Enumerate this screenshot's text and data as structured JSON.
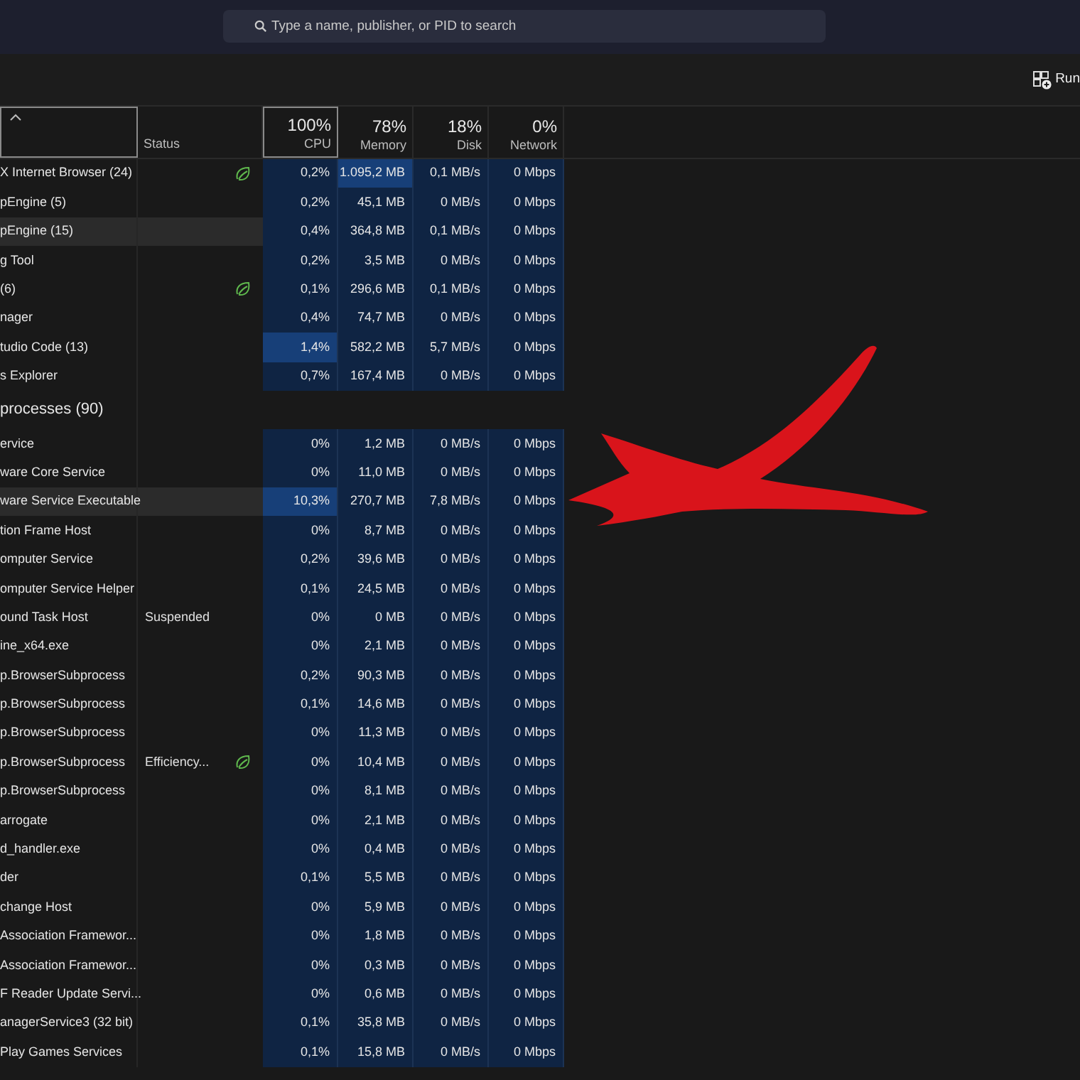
{
  "search": {
    "placeholder": "Type a name, publisher, or PID to search"
  },
  "toolbar": {
    "run_button": "Run"
  },
  "columns": [
    {
      "sort_indicator": true,
      "framed": true
    },
    {
      "label": "Status",
      "framed": false
    },
    {
      "percent": "100%",
      "label": "CPU",
      "framed": true
    },
    {
      "percent": "78%",
      "label": "Memory",
      "framed": false
    },
    {
      "percent": "18%",
      "label": "Disk",
      "framed": false
    },
    {
      "percent": "0%",
      "label": "Network",
      "framed": false
    }
  ],
  "rows": [
    {
      "kind": "process",
      "name": "X Internet Browser (24)",
      "status": "",
      "efficiency": true,
      "highlighted": false,
      "cells": [
        {
          "text": "0,2%",
          "hot": false
        },
        {
          "text": "1.095,2 MB",
          "hot": true
        },
        {
          "text": "0,1 MB/s",
          "hot": false
        },
        {
          "text": "0 Mbps",
          "hot": false
        }
      ]
    },
    {
      "kind": "process",
      "name": "pEngine (5)",
      "status": "",
      "efficiency": false,
      "highlighted": false,
      "cells": [
        {
          "text": "0,2%",
          "hot": false
        },
        {
          "text": "45,1 MB",
          "hot": false
        },
        {
          "text": "0 MB/s",
          "hot": false
        },
        {
          "text": "0 Mbps",
          "hot": false
        }
      ]
    },
    {
      "kind": "process",
      "name": "pEngine (15)",
      "status": "",
      "efficiency": false,
      "highlighted": true,
      "cells": [
        {
          "text": "0,4%",
          "hot": false
        },
        {
          "text": "364,8 MB",
          "hot": false
        },
        {
          "text": "0,1 MB/s",
          "hot": false
        },
        {
          "text": "0 Mbps",
          "hot": false
        }
      ]
    },
    {
      "kind": "process",
      "name": "g Tool",
      "status": "",
      "efficiency": false,
      "highlighted": false,
      "cells": [
        {
          "text": "0,2%",
          "hot": false
        },
        {
          "text": "3,5 MB",
          "hot": false
        },
        {
          "text": "0 MB/s",
          "hot": false
        },
        {
          "text": "0 Mbps",
          "hot": false
        }
      ]
    },
    {
      "kind": "process",
      "name": "(6)",
      "status": "",
      "efficiency": true,
      "highlighted": false,
      "cells": [
        {
          "text": "0,1%",
          "hot": false
        },
        {
          "text": "296,6 MB",
          "hot": false
        },
        {
          "text": "0,1 MB/s",
          "hot": false
        },
        {
          "text": "0 Mbps",
          "hot": false
        }
      ]
    },
    {
      "kind": "process",
      "name": "nager",
      "status": "",
      "efficiency": false,
      "highlighted": false,
      "cells": [
        {
          "text": "0,4%",
          "hot": false
        },
        {
          "text": "74,7 MB",
          "hot": false
        },
        {
          "text": "0 MB/s",
          "hot": false
        },
        {
          "text": "0 Mbps",
          "hot": false
        }
      ]
    },
    {
      "kind": "process",
      "name": "tudio Code (13)",
      "status": "",
      "efficiency": false,
      "highlighted": false,
      "cells": [
        {
          "text": "1,4%",
          "hot": true
        },
        {
          "text": "582,2 MB",
          "hot": false
        },
        {
          "text": "5,7 MB/s",
          "hot": false
        },
        {
          "text": "0 Mbps",
          "hot": false
        }
      ]
    },
    {
      "kind": "process",
      "name": "s Explorer",
      "status": "",
      "efficiency": false,
      "highlighted": false,
      "cells": [
        {
          "text": "0,7%",
          "hot": false
        },
        {
          "text": "167,4 MB",
          "hot": false
        },
        {
          "text": "0 MB/s",
          "hot": false
        },
        {
          "text": "0 Mbps",
          "hot": false
        }
      ]
    },
    {
      "kind": "group",
      "name": "processes (90)"
    },
    {
      "kind": "process",
      "name": "ervice",
      "status": "",
      "efficiency": false,
      "highlighted": false,
      "cells": [
        {
          "text": "0%",
          "hot": false
        },
        {
          "text": "1,2 MB",
          "hot": false
        },
        {
          "text": "0 MB/s",
          "hot": false
        },
        {
          "text": "0 Mbps",
          "hot": false
        }
      ]
    },
    {
      "kind": "process",
      "name": "ware Core Service",
      "status": "",
      "efficiency": false,
      "highlighted": false,
      "cells": [
        {
          "text": "0%",
          "hot": false
        },
        {
          "text": "11,0 MB",
          "hot": false
        },
        {
          "text": "0 MB/s",
          "hot": false
        },
        {
          "text": "0 Mbps",
          "hot": false
        }
      ]
    },
    {
      "kind": "process",
      "name": "ware Service Executable",
      "status": "",
      "efficiency": false,
      "highlighted": true,
      "cells": [
        {
          "text": "10,3%",
          "hot": true
        },
        {
          "text": "270,7 MB",
          "hot": false
        },
        {
          "text": "7,8 MB/s",
          "hot": false
        },
        {
          "text": "0 Mbps",
          "hot": false
        }
      ]
    },
    {
      "kind": "process",
      "name": "tion Frame Host",
      "status": "",
      "efficiency": false,
      "highlighted": false,
      "cells": [
        {
          "text": "0%",
          "hot": false
        },
        {
          "text": "8,7 MB",
          "hot": false
        },
        {
          "text": "0 MB/s",
          "hot": false
        },
        {
          "text": "0 Mbps",
          "hot": false
        }
      ]
    },
    {
      "kind": "process",
      "name": "omputer Service",
      "status": "",
      "efficiency": false,
      "highlighted": false,
      "cells": [
        {
          "text": "0,2%",
          "hot": false
        },
        {
          "text": "39,6 MB",
          "hot": false
        },
        {
          "text": "0 MB/s",
          "hot": false
        },
        {
          "text": "0 Mbps",
          "hot": false
        }
      ]
    },
    {
      "kind": "process",
      "name": "omputer Service Helper",
      "status": "",
      "efficiency": false,
      "highlighted": false,
      "cells": [
        {
          "text": "0,1%",
          "hot": false
        },
        {
          "text": "24,5 MB",
          "hot": false
        },
        {
          "text": "0 MB/s",
          "hot": false
        },
        {
          "text": "0 Mbps",
          "hot": false
        }
      ]
    },
    {
      "kind": "process",
      "name": "ound Task Host",
      "status": "Suspended",
      "efficiency": false,
      "highlighted": false,
      "cells": [
        {
          "text": "0%",
          "hot": false
        },
        {
          "text": "0 MB",
          "hot": false
        },
        {
          "text": "0 MB/s",
          "hot": false
        },
        {
          "text": "0 Mbps",
          "hot": false
        }
      ]
    },
    {
      "kind": "process",
      "name": "ine_x64.exe",
      "status": "",
      "efficiency": false,
      "highlighted": false,
      "cells": [
        {
          "text": "0%",
          "hot": false
        },
        {
          "text": "2,1 MB",
          "hot": false
        },
        {
          "text": "0 MB/s",
          "hot": false
        },
        {
          "text": "0 Mbps",
          "hot": false
        }
      ]
    },
    {
      "kind": "process",
      "name": "p.BrowserSubprocess",
      "status": "",
      "efficiency": false,
      "highlighted": false,
      "cells": [
        {
          "text": "0,2%",
          "hot": false
        },
        {
          "text": "90,3 MB",
          "hot": false
        },
        {
          "text": "0 MB/s",
          "hot": false
        },
        {
          "text": "0 Mbps",
          "hot": false
        }
      ]
    },
    {
      "kind": "process",
      "name": "p.BrowserSubprocess",
      "status": "",
      "efficiency": false,
      "highlighted": false,
      "cells": [
        {
          "text": "0,1%",
          "hot": false
        },
        {
          "text": "14,6 MB",
          "hot": false
        },
        {
          "text": "0 MB/s",
          "hot": false
        },
        {
          "text": "0 Mbps",
          "hot": false
        }
      ]
    },
    {
      "kind": "process",
      "name": "p.BrowserSubprocess",
      "status": "",
      "efficiency": false,
      "highlighted": false,
      "cells": [
        {
          "text": "0%",
          "hot": false
        },
        {
          "text": "11,3 MB",
          "hot": false
        },
        {
          "text": "0 MB/s",
          "hot": false
        },
        {
          "text": "0 Mbps",
          "hot": false
        }
      ]
    },
    {
      "kind": "process",
      "name": "p.BrowserSubprocess",
      "status": "Efficiency...",
      "efficiency": true,
      "highlighted": false,
      "cells": [
        {
          "text": "0%",
          "hot": false
        },
        {
          "text": "10,4 MB",
          "hot": false
        },
        {
          "text": "0 MB/s",
          "hot": false
        },
        {
          "text": "0 Mbps",
          "hot": false
        }
      ]
    },
    {
      "kind": "process",
      "name": "p.BrowserSubprocess",
      "status": "",
      "efficiency": false,
      "highlighted": false,
      "cells": [
        {
          "text": "0%",
          "hot": false
        },
        {
          "text": "8,1 MB",
          "hot": false
        },
        {
          "text": "0 MB/s",
          "hot": false
        },
        {
          "text": "0 Mbps",
          "hot": false
        }
      ]
    },
    {
      "kind": "process",
      "name": "arrogate",
      "status": "",
      "efficiency": false,
      "highlighted": false,
      "cells": [
        {
          "text": "0%",
          "hot": false
        },
        {
          "text": "2,1 MB",
          "hot": false
        },
        {
          "text": "0 MB/s",
          "hot": false
        },
        {
          "text": "0 Mbps",
          "hot": false
        }
      ]
    },
    {
      "kind": "process",
      "name": "d_handler.exe",
      "status": "",
      "efficiency": false,
      "highlighted": false,
      "cells": [
        {
          "text": "0%",
          "hot": false
        },
        {
          "text": "0,4 MB",
          "hot": false
        },
        {
          "text": "0 MB/s",
          "hot": false
        },
        {
          "text": "0 Mbps",
          "hot": false
        }
      ]
    },
    {
      "kind": "process",
      "name": "der",
      "status": "",
      "efficiency": false,
      "highlighted": false,
      "cells": [
        {
          "text": "0,1%",
          "hot": false
        },
        {
          "text": "5,5 MB",
          "hot": false
        },
        {
          "text": "0 MB/s",
          "hot": false
        },
        {
          "text": "0 Mbps",
          "hot": false
        }
      ]
    },
    {
      "kind": "process",
      "name": "change Host",
      "status": "",
      "efficiency": false,
      "highlighted": false,
      "cells": [
        {
          "text": "0%",
          "hot": false
        },
        {
          "text": "5,9 MB",
          "hot": false
        },
        {
          "text": "0 MB/s",
          "hot": false
        },
        {
          "text": "0 Mbps",
          "hot": false
        }
      ]
    },
    {
      "kind": "process",
      "name": "Association Framewor...",
      "status": "",
      "efficiency": false,
      "highlighted": false,
      "cells": [
        {
          "text": "0%",
          "hot": false
        },
        {
          "text": "1,8 MB",
          "hot": false
        },
        {
          "text": "0 MB/s",
          "hot": false
        },
        {
          "text": "0 Mbps",
          "hot": false
        }
      ]
    },
    {
      "kind": "process",
      "name": "Association Framewor...",
      "status": "",
      "efficiency": false,
      "highlighted": false,
      "cells": [
        {
          "text": "0%",
          "hot": false
        },
        {
          "text": "0,3 MB",
          "hot": false
        },
        {
          "text": "0 MB/s",
          "hot": false
        },
        {
          "text": "0 Mbps",
          "hot": false
        }
      ]
    },
    {
      "kind": "process",
      "name": "F Reader Update Servi...",
      "status": "",
      "efficiency": false,
      "highlighted": false,
      "cells": [
        {
          "text": "0%",
          "hot": false
        },
        {
          "text": "0,6 MB",
          "hot": false
        },
        {
          "text": "0 MB/s",
          "hot": false
        },
        {
          "text": "0 Mbps",
          "hot": false
        }
      ]
    },
    {
      "kind": "process",
      "name": "anagerService3 (32 bit)",
      "status": "",
      "efficiency": false,
      "highlighted": false,
      "cells": [
        {
          "text": "0,1%",
          "hot": false
        },
        {
          "text": "35,8 MB",
          "hot": false
        },
        {
          "text": "0 MB/s",
          "hot": false
        },
        {
          "text": "0 Mbps",
          "hot": false
        }
      ]
    },
    {
      "kind": "process",
      "name": "Play Games Services",
      "status": "",
      "efficiency": false,
      "highlighted": false,
      "cells": [
        {
          "text": "0,1%",
          "hot": false
        },
        {
          "text": "15,8 MB",
          "hot": false
        },
        {
          "text": "0 MB/s",
          "hot": false
        },
        {
          "text": "0 Mbps",
          "hot": false
        }
      ]
    }
  ]
}
